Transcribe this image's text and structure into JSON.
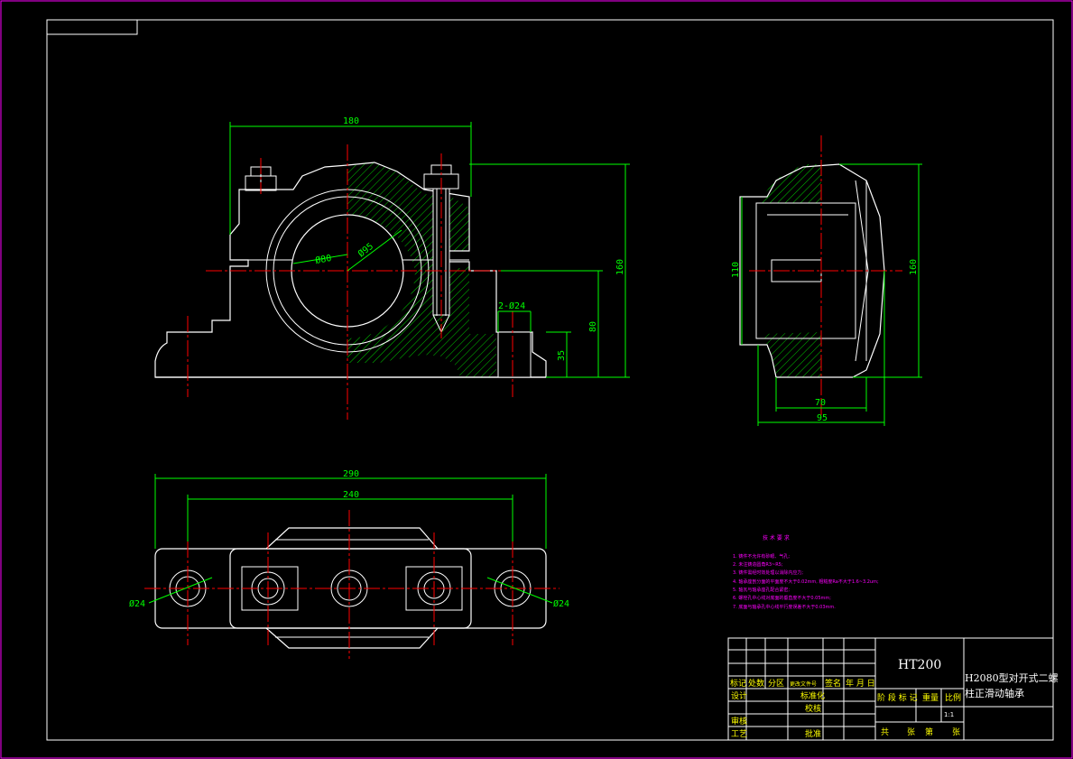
{
  "dimensions": {
    "front_width": "180",
    "front_height": "160",
    "center_height": "80",
    "base_height": "35",
    "bore_outer": "Ø95",
    "bore_inner": "Ø80",
    "bolt_holes": "2-Ø24",
    "side_inner_height": "110",
    "side_height": "160",
    "side_width_70": "70",
    "side_width_95": "95",
    "top_length": "290",
    "top_hole_spacing": "240",
    "top_hole_left": "Ø24",
    "top_hole_right": "Ø24"
  },
  "tech_notes": {
    "title": "技 术 要 求",
    "items": [
      "1. 铸件不允许有砂眼、气孔;",
      "2. 未注铸造圆角R3~R5;",
      "3. 铸件需经时效处理以消除内应力;",
      "4. 轴承座剖分面的平面度不大于0.02mm, 粗糙度Ra不大于1.6~3.2um;",
      "5. 轴瓦与轴承座孔配合紧密;",
      "6. 螺栓孔中心线对底面的垂直度不大于0.05mm;",
      "7. 底面与轴承孔中心线平行度误差不大于0.03mm."
    ]
  },
  "title_block": {
    "material": "HT200",
    "part_name_line1": "H2080型对开式二螺",
    "part_name_line2": "柱正滑动轴承",
    "header_labels": [
      "标记",
      "处数",
      "分区",
      "更改文件号",
      "签名",
      "年 月 日"
    ],
    "row_labels": [
      "设计",
      "审核",
      "工艺"
    ],
    "mid_labels": [
      "标准化",
      "校核",
      "批准"
    ],
    "stage_labels": [
      "阶 段 标 记",
      "重量",
      "比例"
    ],
    "scale": "1:1",
    "sheet_labels": [
      "共",
      "张",
      "第",
      "张"
    ]
  },
  "colors": {
    "background": "#000000",
    "outline": "#ffffff",
    "dimension": "#00ff00",
    "centerline": "#ff0000",
    "notes": "#ff00ff",
    "title_text": "#ffff00",
    "border": "#ff00ff"
  }
}
